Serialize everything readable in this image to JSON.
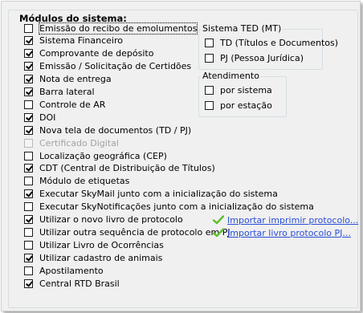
{
  "group_title": "Módulos do sistema:",
  "modules": [
    {
      "label": "Emissão do recibo de emolumentos",
      "checked": false,
      "disabled": false,
      "focused": true
    },
    {
      "label": "Sistema Financeiro",
      "checked": true,
      "disabled": false
    },
    {
      "label": "Comprovante de depósito",
      "checked": true,
      "disabled": false
    },
    {
      "label": "Emissão / Solicitação de Certidões",
      "checked": true,
      "disabled": false
    },
    {
      "label": "Nota de entrega",
      "checked": true,
      "disabled": false
    },
    {
      "label": "Barra lateral",
      "checked": true,
      "disabled": false
    },
    {
      "label": "Controle de AR",
      "checked": false,
      "disabled": false
    },
    {
      "label": "DOI",
      "checked": true,
      "disabled": false
    },
    {
      "label": "Nova tela de documentos (TD / PJ)",
      "checked": true,
      "disabled": false
    },
    {
      "label": "Certificado Digital",
      "checked": false,
      "disabled": true
    },
    {
      "label": "Localização geográfica (CEP)",
      "checked": false,
      "disabled": false
    },
    {
      "label": "CDT (Central de Distribuição de Títulos)",
      "checked": true,
      "disabled": false
    },
    {
      "label": "Módulo de etiquetas",
      "checked": false,
      "disabled": false
    },
    {
      "label": "Executar SkyMail junto com a inicialização do sistema",
      "checked": true,
      "disabled": false
    },
    {
      "label": "Executar SkyNotificações junto com a inicialização do sistema",
      "checked": false,
      "disabled": false
    },
    {
      "label": "Utilizar o novo livro de protocolo",
      "checked": true,
      "disabled": false
    },
    {
      "label": "Utilizar outra sequência de protocolo em PJ",
      "checked": false,
      "disabled": false
    },
    {
      "label": "Utilizar Livro de Ocorrências",
      "checked": false,
      "disabled": false
    },
    {
      "label": "Utilizar cadastro de animais",
      "checked": true,
      "disabled": false
    },
    {
      "label": "Apostilamento",
      "checked": false,
      "disabled": false
    },
    {
      "label": "Central RTD Brasil",
      "checked": true,
      "disabled": false
    }
  ],
  "ted_group": {
    "title": "Sistema TED (MT)",
    "options": [
      {
        "label": "TD (Títulos e Documentos)",
        "checked": false
      },
      {
        "label": "PJ (Pessoa Jurídica)",
        "checked": false
      }
    ]
  },
  "atendimento_group": {
    "title": "Atendimento",
    "options": [
      {
        "label": "por sistema",
        "checked": false
      },
      {
        "label": "por estação",
        "checked": false
      }
    ]
  },
  "links": [
    {
      "label": "Importar imprimir protocolo...",
      "icon": "green-check-icon"
    },
    {
      "label": "Importar livro protocolo PJ...",
      "icon": "green-check-icon"
    }
  ],
  "colors": {
    "link": "#2a4fd6",
    "check_icon": "#5cbf2a",
    "disabled_text": "#a2a2a2"
  }
}
